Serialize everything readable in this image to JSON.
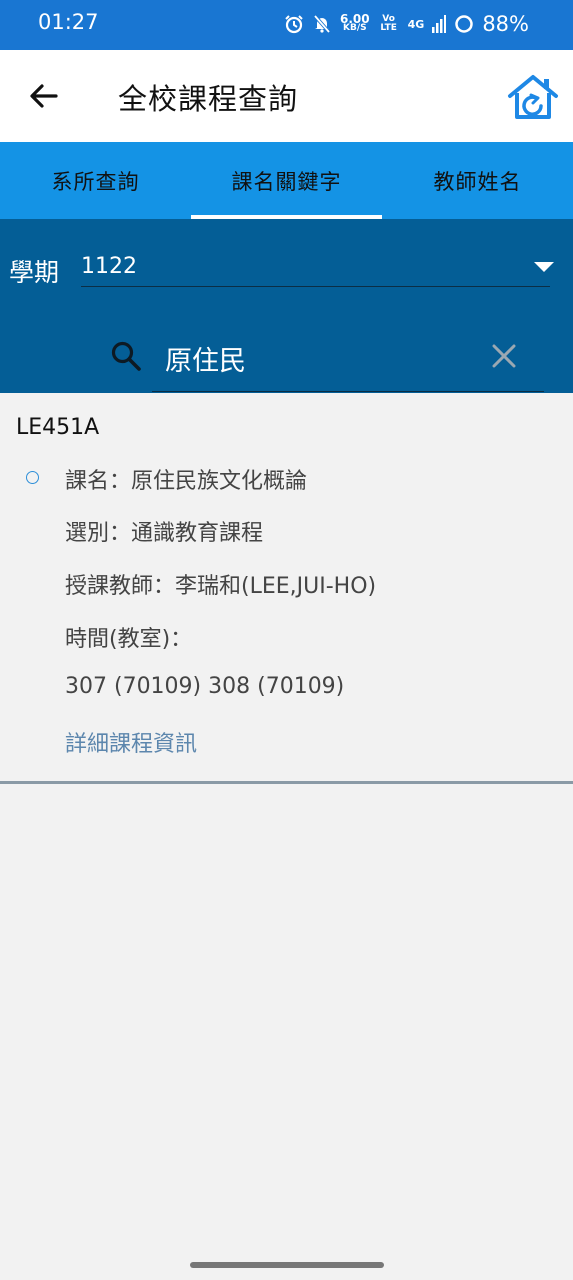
{
  "status_bar": {
    "time": "01:27",
    "network_speed": "6.00",
    "network_unit": "KB/S",
    "volte": "Vo LTE",
    "signal": "4G",
    "battery": "88%"
  },
  "app_bar": {
    "title": "全校課程查詢"
  },
  "tabs": [
    {
      "label": "系所查詢",
      "active": false
    },
    {
      "label": "課名關鍵字",
      "active": true
    },
    {
      "label": "教師姓名",
      "active": false
    }
  ],
  "search": {
    "term_label": "學期",
    "term_value": "1122",
    "query": "原住民"
  },
  "result": {
    "code": "LE451A",
    "course_name": "課名：原住民族文化概論",
    "category": "選別：通識教育課程",
    "teacher": "授課教師：李瑞和(LEE,JUI-HO)",
    "time_label": "時間(教室)：",
    "time_value": "307 (70109)  308 (70109)",
    "detail_link": "詳細課程資訊"
  },
  "colors": {
    "status_bar": "#1976d2",
    "tab_bar": "#1493e5",
    "search_panel": "#045e96",
    "link": "#5c86ad",
    "home_icon": "#1e88e5"
  }
}
